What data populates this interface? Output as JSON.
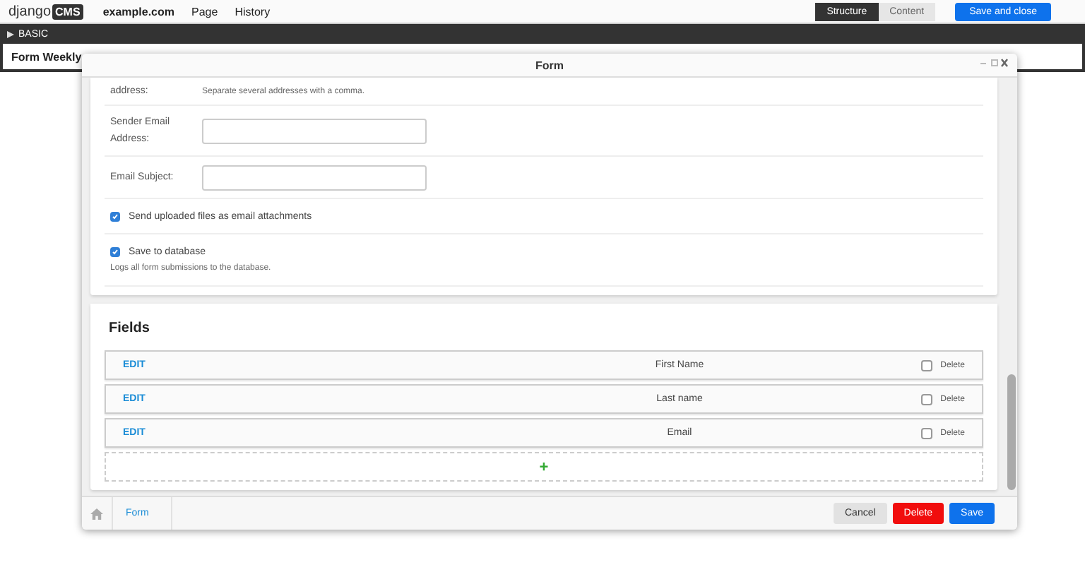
{
  "toolbar": {
    "logo_text": "django",
    "logo_badge": "CMS",
    "site": "example.com",
    "menu": [
      "Page",
      "History"
    ],
    "modes": [
      {
        "label": "Structure",
        "selected": true
      },
      {
        "label": "Content",
        "selected": false
      }
    ],
    "primary": "Save and close"
  },
  "structure_bar": {
    "label": "BASIC"
  },
  "plugin": {
    "title": "Form Weekly"
  },
  "modal": {
    "title": "Form",
    "form_rows": [
      {
        "kind": "help",
        "label": "address:",
        "help": "Separate several addresses with a comma."
      },
      {
        "kind": "text",
        "label": "Sender Email Address:"
      },
      {
        "kind": "text",
        "label": "Email Subject:"
      },
      {
        "kind": "checkbox",
        "label": "Send uploaded files as email attachments",
        "checked": true
      },
      {
        "kind": "checkbox",
        "label": "Save to database",
        "checked": true,
        "help": "Logs all form submissions to the database."
      }
    ],
    "fields": {
      "title": "Fields",
      "add": "+",
      "rows": [
        {
          "edit": "EDIT",
          "name": "First Name",
          "delete": "Delete",
          "checked": false
        },
        {
          "edit": "EDIT",
          "name": "Last name",
          "delete": "Delete",
          "checked": false
        },
        {
          "edit": "EDIT",
          "name": "Email",
          "delete": "Delete",
          "checked": false
        }
      ]
    },
    "breadcrumb": "Form",
    "buttons": [
      {
        "label": "Cancel",
        "kind": "default"
      },
      {
        "label": "Delete",
        "kind": "danger"
      },
      {
        "label": "Save",
        "kind": "primary"
      }
    ]
  }
}
